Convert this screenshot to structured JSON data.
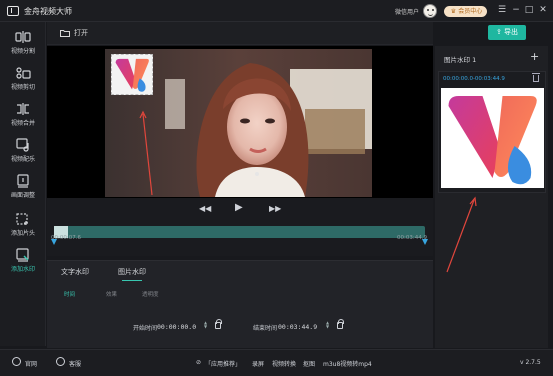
{
  "app": {
    "title": "金舟视频大师"
  },
  "header": {
    "user_name": "微信用户",
    "vip_label": "会员中心",
    "menu_icon": "menu-icon",
    "minimize_icon": "minimize-icon",
    "maximize_icon": "maximize-icon",
    "close_icon": "close-icon"
  },
  "sidebar": {
    "items": [
      {
        "label": "视频分割",
        "icon": "split-icon"
      },
      {
        "label": "视频剪切",
        "icon": "scissors-icon"
      },
      {
        "label": "视频合并",
        "icon": "merge-icon"
      },
      {
        "label": "视频配乐",
        "icon": "music-icon"
      },
      {
        "label": "画面调整",
        "icon": "crop-icon"
      },
      {
        "label": "添加片头",
        "icon": "intro-icon"
      },
      {
        "label": "添加水印",
        "icon": "watermark-icon",
        "active": true
      }
    ]
  },
  "toolbar": {
    "open_label": "打开",
    "export_label": "导出"
  },
  "timeline": {
    "start_time": "00:00:07.6",
    "end_time": "00:03:44.9"
  },
  "bottom": {
    "tabs": [
      "文字水印",
      "图片水印"
    ],
    "active_tab": "图片水印",
    "subtabs": [
      "时间",
      "效果",
      "透明度"
    ],
    "active_subtab": "时间",
    "start_label": "开始时间",
    "start_value": "00:00:00.0",
    "end_label": "结束时间",
    "end_value": "00:03:44.9"
  },
  "right_panel": {
    "title": "图片水印 1",
    "time_range": "00:00:00.0-00:03:44.9"
  },
  "statusbar": {
    "website": "官网",
    "service": "客服",
    "promo": "「应用推荐」",
    "links": [
      "录屏",
      "视频转换",
      "抠图",
      "m3u8视频转mp4"
    ],
    "version": "v 2.7.5"
  },
  "colors": {
    "accent": "#1fb7a0",
    "highlight": "#38c6b0",
    "time_blue": "#38a6e0",
    "arrow_red": "#e0463c"
  }
}
